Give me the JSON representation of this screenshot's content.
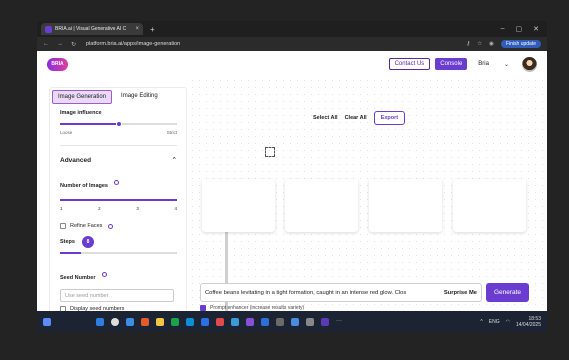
{
  "browser": {
    "tab_title": "BRIA.ai | Visual Generative AI C",
    "tab_close": "×",
    "new_tab": "+",
    "window_controls": [
      "–",
      "▢",
      "✕"
    ],
    "nav": [
      "←",
      "→",
      "↻"
    ],
    "url": "platform.bria.ai/apps/image-generation",
    "finish_update": "Finish update"
  },
  "header": {
    "logo": "BRIA",
    "contact": "Contact Us",
    "console": "Console",
    "user": "Bria",
    "caret": "⌄"
  },
  "panel": {
    "tabs": [
      "Image Generation",
      "Image Editing"
    ],
    "image_influence": {
      "label": "Image influence",
      "min_label": "Loose",
      "max_label": "Strict",
      "value": 0.5
    },
    "advanced": {
      "label": "Advanced",
      "chevron": "⌃"
    },
    "num_images": {
      "label": "Number of Images",
      "ticks": [
        "1",
        "2",
        "3",
        "4"
      ],
      "selected": "4"
    },
    "refine_faces": {
      "label": "Refine Faces",
      "checked": false
    },
    "steps": {
      "label": "Steps",
      "value": "8",
      "fraction": 0.18
    },
    "seed": {
      "label": "Seed Number",
      "placeholder": "Use seed number",
      "display_label": "Display seed numbers"
    }
  },
  "toolbar": {
    "select_all": "Select All",
    "clear_all": "Clear All",
    "export": "Export"
  },
  "prompt": {
    "text": "Coffee beans levitating in a tight formation, caught in an intense red glow. Clos",
    "surprise": "Surprise Me",
    "generate": "Generate",
    "enhancer": "Prompt enhancer (increase results variety)"
  },
  "taskbar": {
    "lang": "ENG",
    "time": "18:53",
    "date": "14/04/2025",
    "more": "···"
  },
  "colors": {
    "accent": "#6a3ccf",
    "taskbar": "#1c2433"
  }
}
